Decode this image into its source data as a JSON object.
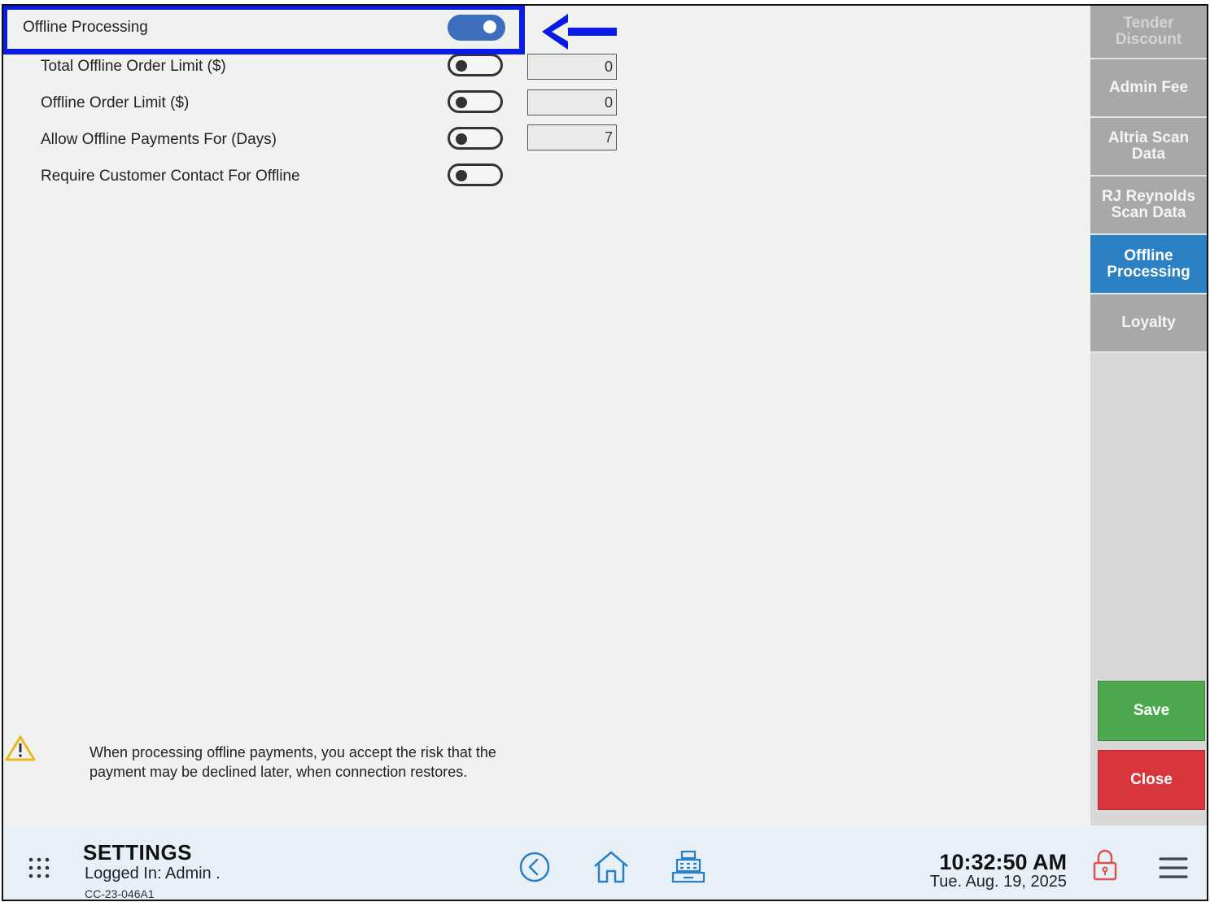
{
  "settings": {
    "offline_processing": {
      "label": "Offline Processing",
      "enabled": true
    },
    "rows": [
      {
        "label": "Total Offline Order Limit ($)",
        "enabled": false,
        "value": "0"
      },
      {
        "label": "Offline Order Limit ($)",
        "enabled": false,
        "value": "0"
      },
      {
        "label": "Allow Offline Payments For (Days)",
        "enabled": false,
        "value": "7"
      },
      {
        "label": "Require Customer Contact For Offline",
        "enabled": false
      }
    ]
  },
  "warning": {
    "icon": "warning-triangle-icon",
    "text_line1": "When processing offline payments, you accept the risk that the",
    "text_line2": "payment may be declined later, when connection restores."
  },
  "sidebar": {
    "items": [
      {
        "label_line1": "Tender",
        "label_line2": "Discount"
      },
      {
        "label_line1": "Admin Fee",
        "label_line2": ""
      },
      {
        "label_line1": "Altria Scan",
        "label_line2": "Data"
      },
      {
        "label_line1": "RJ Reynolds",
        "label_line2": "Scan Data"
      },
      {
        "label_line1": "Offline",
        "label_line2": "Processing"
      },
      {
        "label_line1": "Loyalty",
        "label_line2": ""
      }
    ],
    "active_index": 4
  },
  "actions": {
    "save_label": "Save",
    "close_label": "Close"
  },
  "footer": {
    "title": "SETTINGS",
    "logged_in": "Logged In:  Admin .",
    "device_id": "CC-23-046A1",
    "time": "10:32:50 AM",
    "date": "Tue. Aug. 19, 2025"
  },
  "colors": {
    "accent_blue": "#2b7fc3",
    "toggle_on": "#3d6dbd",
    "highlight": "#0a1be6",
    "save": "#4ea94e",
    "close": "#d8363d",
    "warning": "#e8b923",
    "lock": "#d9534f"
  }
}
